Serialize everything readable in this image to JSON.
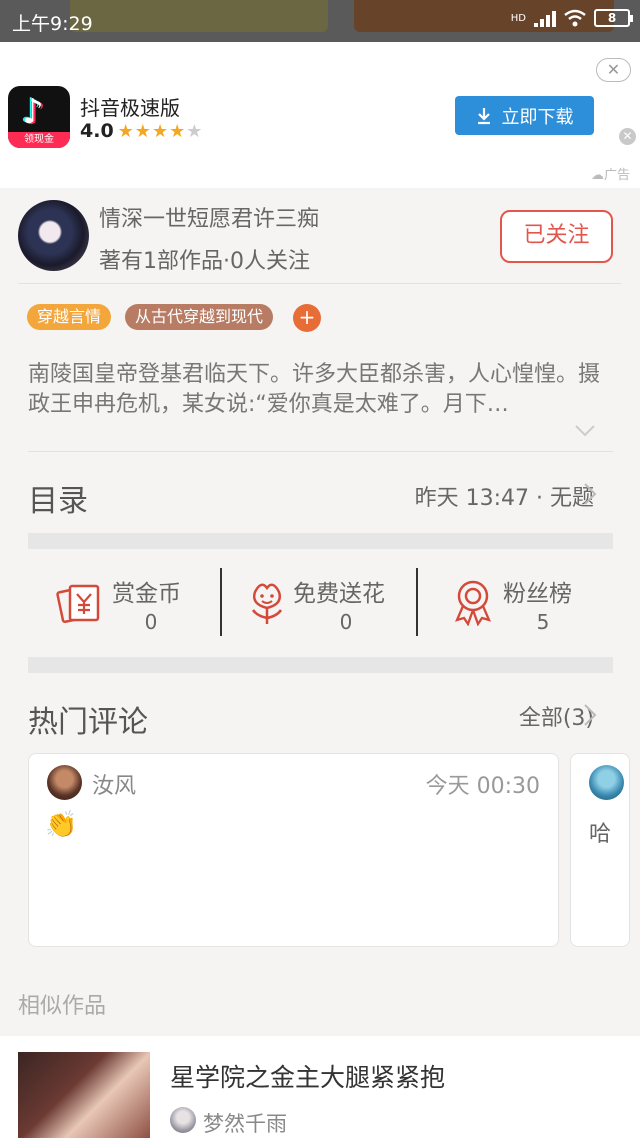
{
  "status_bar": {
    "time": "上午9:29",
    "network": "HD",
    "battery": "8"
  },
  "ad": {
    "app_icon_tag": "领现金",
    "app_name": "抖音极速版",
    "rating": "4.0",
    "stars": 4,
    "download_label": "立即下载",
    "ad_label": "广告"
  },
  "author": {
    "name": "情深一世短愿君许三痴",
    "meta": "著有1部作品·0人关注",
    "follow_label": "已关注"
  },
  "tags": [
    "穿越言情",
    "从古代穿越到现代"
  ],
  "synopsis": "南陵国皇帝登基君临天下。许多大臣都杀害，人心惶惶。摄政王申冉危机，某女说:“爱你真是太难了。月下…",
  "catalog": {
    "title": "目录",
    "latest": "昨天 13:47 · 无题"
  },
  "stats": [
    {
      "label": "赏金币",
      "value": "0"
    },
    {
      "label": "免费送花",
      "value": "0"
    },
    {
      "label": "粉丝榜",
      "value": "5"
    }
  ],
  "hot_comments": {
    "title": "热门评论",
    "all_label": "全部(3)",
    "items": [
      {
        "user": "汝风",
        "time": "今天 00:30",
        "body": "👏"
      },
      {
        "user": "",
        "time": "",
        "body": "哈"
      }
    ]
  },
  "similar": {
    "label": "相似作品",
    "items": [
      {
        "title": "星学院之金主大腿紧紧抱",
        "author": "梦然千雨"
      }
    ]
  }
}
